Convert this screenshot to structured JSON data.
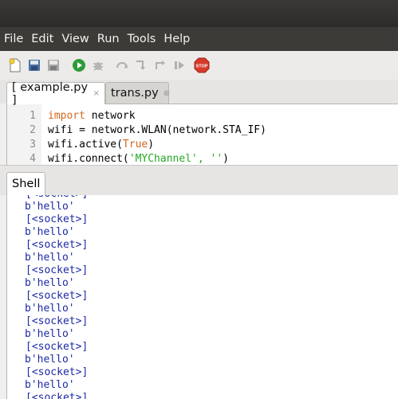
{
  "menu": [
    "File",
    "Edit",
    "View",
    "Run",
    "Tools",
    "Help"
  ],
  "toolbar": {
    "icons": [
      "new-file-icon",
      "open-file-icon",
      "save-file-icon",
      "run-icon",
      "debug-icon",
      "step-over-icon",
      "step-into-icon",
      "step-out-icon",
      "resume-icon",
      "stop-icon"
    ],
    "stop_label": "STOP"
  },
  "editor_tabs": [
    {
      "label": "[ example.py ]",
      "close": "×"
    },
    {
      "label": "trans.py",
      "close": "⊗"
    }
  ],
  "editor": {
    "line_numbers": [
      "1",
      "2",
      "3",
      "4"
    ],
    "lines": [
      {
        "kw": "import",
        "rest": " network"
      },
      {
        "pre": "wifi = network.WLAN(network.STA_IF)"
      },
      {
        "pre": "wifi.active(",
        "kw": "True",
        "post": ")"
      },
      {
        "pre": "wifi.connect(",
        "str": "'MYChannel', ''",
        "post": ")"
      }
    ]
  },
  "shell_tab": "Shell",
  "shell_lines": [
    "[<socket>]",
    "b'hello'",
    "[<socket>]",
    "b'hello'",
    "[<socket>]",
    "b'hello'",
    "[<socket>]",
    "b'hello'",
    "[<socket>]",
    "b'hello'",
    "[<socket>]",
    "b'hello'",
    "[<socket>]",
    "b'hello'",
    "[<socket>]",
    "b'hello'",
    "[<socket>]"
  ],
  "colors": {
    "menubar": "#3c3b37",
    "keyword": "#d2691e",
    "string": "#26a926",
    "shell_text": "#1d2aa5"
  }
}
